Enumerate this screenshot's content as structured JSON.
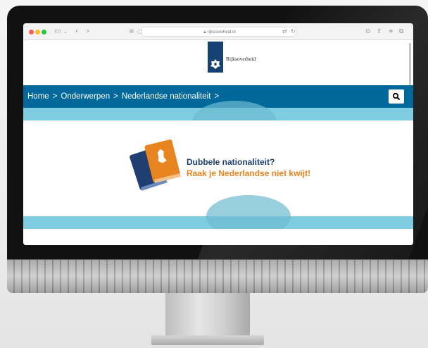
{
  "browser": {
    "url": "rijksoverheid.nl",
    "icons": [
      "sidebar-icon",
      "chevron-down-icon",
      "back-icon",
      "forward-icon",
      "reader-icon",
      "shield-icon",
      "translate-icon",
      "reload-icon",
      "download-icon",
      "share-icon",
      "new-tab-icon",
      "tabs-icon"
    ]
  },
  "header": {
    "logo_text": "Rijksoverheid"
  },
  "breadcrumb": {
    "items": [
      "Home",
      "Onderwerpen",
      "Nederlandse nationaliteit"
    ],
    "separator": ">"
  },
  "banner": {
    "title": "Dubbele nationaliteit?",
    "subtitle": "Raak je Nederlandse niet kwijt!"
  },
  "colors": {
    "nav": "#01689b",
    "band": "#7fcbe0",
    "logo": "#154273",
    "title": "#1f3f73",
    "accent": "#e8841f"
  }
}
